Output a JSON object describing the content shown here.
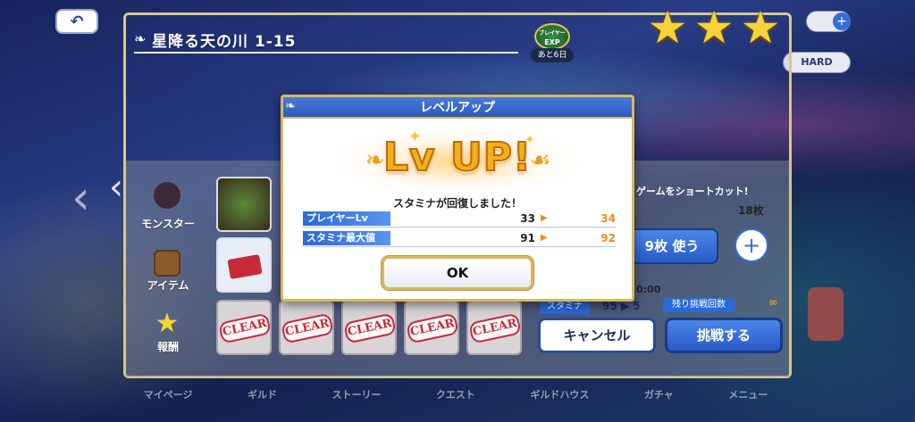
{
  "stage": {
    "title": "星降る天の川 1-15",
    "exp_badge_top": "ブレイヤー",
    "exp_badge_main": "EXP",
    "exp_days": "あと6日",
    "difficulty": "HARD"
  },
  "sidebar": {
    "monster_label": "モンスター",
    "item_label": "アイテム",
    "reward_label": "報酬"
  },
  "clear_stamps": [
    "CLEAR",
    "CLEAR",
    "CLEAR",
    "CLEAR",
    "CLEAR"
  ],
  "right_panel": {
    "shortcut_text": "ゲームをショートカット!",
    "ticket_count": "18枚",
    "use_button": "9枚 使う",
    "time_text": "0:00",
    "stamina_label": "スタミナ",
    "stamina_cost": "95 ▶ 5",
    "retry_label": "残り挑戦回数",
    "retry_value": "∞",
    "cancel_button": "キャンセル",
    "challenge_button": "挑戦する"
  },
  "bottom_nav": [
    "マイページ",
    "ギルド",
    "ストーリー",
    "クエスト",
    "ギルドハウス",
    "ガチャ",
    "メニュー"
  ],
  "modal": {
    "header": "レベルアップ",
    "lvup_text": "Lv UP!",
    "recover_message": "スタミナが回復しました！",
    "stats": [
      {
        "label": "プレイヤーLv",
        "old": "33",
        "new": "34"
      },
      {
        "label": "スタミナ最大値",
        "old": "91",
        "new": "92"
      }
    ],
    "ok_button": "OK"
  },
  "icons": {
    "back": "back-arrow-icon",
    "star": "star-icon",
    "plus": "plus-icon",
    "arrow": "triangle-right-icon"
  },
  "colors": {
    "accent_blue": "#2a5ac8",
    "gold": "#d8b85a",
    "stat_new": "#e8901a",
    "clear_red": "#c82a3a",
    "star_yellow": "#f6d23a"
  }
}
